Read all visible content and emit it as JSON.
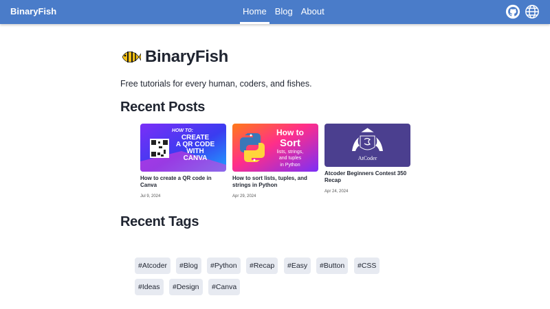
{
  "nav": {
    "brand": "BinaryFish",
    "links": [
      {
        "label": "Home",
        "active": true
      },
      {
        "label": "Blog",
        "active": false
      },
      {
        "label": "About",
        "active": false
      }
    ],
    "icons": [
      "github-icon",
      "globe-icon"
    ],
    "color": "#4a7cc9"
  },
  "hero": {
    "title": "BinaryFish",
    "tagline": "Free tutorials for every human, coders, and fishes."
  },
  "recent_posts": {
    "heading": "Recent Posts",
    "posts": [
      {
        "title": "How to create a QR code in Canva",
        "date": "Jul 9, 2024",
        "thumb_text": {
          "how_to": "HOW TO:",
          "line1": "CREATE",
          "line2": "A QR CODE",
          "line3": "WITH",
          "line4": "CANVA"
        }
      },
      {
        "title": "How to sort lists, tuples, and strings in Python",
        "date": "Apr 29, 2024",
        "thumb_text": {
          "line1": "How to",
          "line2": "Sort",
          "line3": "lists, strings,",
          "line4": "and tuples",
          "line5": "in Python"
        }
      },
      {
        "title": "Atcoder Beginners Contest 350 Recap",
        "date": "Apr 24, 2024",
        "thumb_text": {
          "line1": "AtCoder"
        }
      }
    ]
  },
  "recent_tags": {
    "heading": "Recent Tags",
    "tags": [
      "#Atcoder",
      "#Blog",
      "#Python",
      "#Recap",
      "#Easy",
      "#Button",
      "#CSS",
      "#Ideas",
      "#Design",
      "#Canva"
    ]
  }
}
